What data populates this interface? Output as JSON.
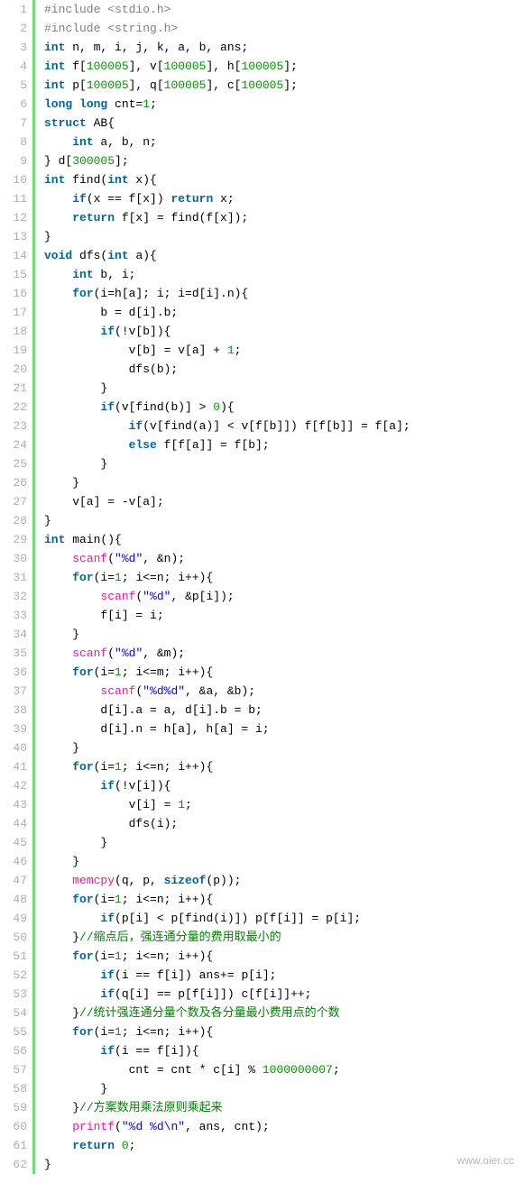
{
  "watermark": "www.oier.cc",
  "lines": [
    {
      "n": 1,
      "tokens": [
        [
          "pp",
          "#include <stdio.h>"
        ]
      ]
    },
    {
      "n": 2,
      "tokens": [
        [
          "pp",
          "#include <string.h>"
        ]
      ]
    },
    {
      "n": 3,
      "tokens": [
        [
          "kw",
          "int"
        ],
        [
          "id",
          " n, m, i, j, k, a, b, ans;"
        ]
      ]
    },
    {
      "n": 4,
      "tokens": [
        [
          "kw",
          "int"
        ],
        [
          "id",
          " f["
        ],
        [
          "num",
          "100005"
        ],
        [
          "id",
          "], v["
        ],
        [
          "num",
          "100005"
        ],
        [
          "id",
          "], h["
        ],
        [
          "num",
          "100005"
        ],
        [
          "id",
          "];"
        ]
      ]
    },
    {
      "n": 5,
      "tokens": [
        [
          "kw",
          "int"
        ],
        [
          "id",
          " p["
        ],
        [
          "num",
          "100005"
        ],
        [
          "id",
          "], q["
        ],
        [
          "num",
          "100005"
        ],
        [
          "id",
          "], c["
        ],
        [
          "num",
          "100005"
        ],
        [
          "id",
          "];"
        ]
      ]
    },
    {
      "n": 6,
      "tokens": [
        [
          "kw",
          "long"
        ],
        [
          "id",
          " "
        ],
        [
          "kw",
          "long"
        ],
        [
          "id",
          " cnt="
        ],
        [
          "num",
          "1"
        ],
        [
          "id",
          ";"
        ]
      ]
    },
    {
      "n": 7,
      "tokens": [
        [
          "kw",
          "struct"
        ],
        [
          "id",
          " AB{"
        ]
      ]
    },
    {
      "n": 8,
      "tokens": [
        [
          "id",
          "    "
        ],
        [
          "kw",
          "int"
        ],
        [
          "id",
          " a, b, n;"
        ]
      ]
    },
    {
      "n": 9,
      "tokens": [
        [
          "id",
          "} d["
        ],
        [
          "num",
          "300005"
        ],
        [
          "id",
          "];"
        ]
      ]
    },
    {
      "n": 10,
      "tokens": [
        [
          "kw",
          "int"
        ],
        [
          "id",
          " find("
        ],
        [
          "kw",
          "int"
        ],
        [
          "id",
          " x){"
        ]
      ]
    },
    {
      "n": 11,
      "tokens": [
        [
          "id",
          "    "
        ],
        [
          "kw",
          "if"
        ],
        [
          "id",
          "(x == f[x]) "
        ],
        [
          "kw",
          "return"
        ],
        [
          "id",
          " x;"
        ]
      ]
    },
    {
      "n": 12,
      "tokens": [
        [
          "id",
          "    "
        ],
        [
          "kw",
          "return"
        ],
        [
          "id",
          " f[x] = find(f[x]);"
        ]
      ]
    },
    {
      "n": 13,
      "tokens": [
        [
          "id",
          "}"
        ]
      ]
    },
    {
      "n": 14,
      "tokens": [
        [
          "kw",
          "void"
        ],
        [
          "id",
          " dfs("
        ],
        [
          "kw",
          "int"
        ],
        [
          "id",
          " a){"
        ]
      ]
    },
    {
      "n": 15,
      "tokens": [
        [
          "id",
          "    "
        ],
        [
          "kw",
          "int"
        ],
        [
          "id",
          " b, i;"
        ]
      ]
    },
    {
      "n": 16,
      "tokens": [
        [
          "id",
          "    "
        ],
        [
          "kw",
          "for"
        ],
        [
          "id",
          "(i=h[a]; i; i=d[i].n){"
        ]
      ]
    },
    {
      "n": 17,
      "tokens": [
        [
          "id",
          "        b = d[i].b;"
        ]
      ]
    },
    {
      "n": 18,
      "tokens": [
        [
          "id",
          "        "
        ],
        [
          "kw",
          "if"
        ],
        [
          "id",
          "(!v[b]){"
        ]
      ]
    },
    {
      "n": 19,
      "tokens": [
        [
          "id",
          "            v[b] = v[a] + "
        ],
        [
          "num",
          "1"
        ],
        [
          "id",
          ";"
        ]
      ]
    },
    {
      "n": 20,
      "tokens": [
        [
          "id",
          "            dfs(b);"
        ]
      ]
    },
    {
      "n": 21,
      "tokens": [
        [
          "id",
          "        }"
        ]
      ]
    },
    {
      "n": 22,
      "tokens": [
        [
          "id",
          "        "
        ],
        [
          "kw",
          "if"
        ],
        [
          "id",
          "(v[find(b)] > "
        ],
        [
          "num",
          "0"
        ],
        [
          "id",
          "){"
        ]
      ]
    },
    {
      "n": 23,
      "tokens": [
        [
          "id",
          "            "
        ],
        [
          "kw",
          "if"
        ],
        [
          "id",
          "(v[find(a)] < v[f[b]]) f[f[b]] = f[a];"
        ]
      ]
    },
    {
      "n": 24,
      "tokens": [
        [
          "id",
          "            "
        ],
        [
          "kw",
          "else"
        ],
        [
          "id",
          " f[f[a]] = f[b];"
        ]
      ]
    },
    {
      "n": 25,
      "tokens": [
        [
          "id",
          "        }"
        ]
      ]
    },
    {
      "n": 26,
      "tokens": [
        [
          "id",
          "    }"
        ]
      ]
    },
    {
      "n": 27,
      "tokens": [
        [
          "id",
          "    v[a] = -v[a];"
        ]
      ]
    },
    {
      "n": 28,
      "tokens": [
        [
          "id",
          "}"
        ]
      ]
    },
    {
      "n": 29,
      "tokens": [
        [
          "kw",
          "int"
        ],
        [
          "id",
          " main(){"
        ]
      ]
    },
    {
      "n": 30,
      "tokens": [
        [
          "id",
          "    "
        ],
        [
          "fn",
          "scanf"
        ],
        [
          "id",
          "("
        ],
        [
          "str",
          "\"%d\""
        ],
        [
          "id",
          ", &n);"
        ]
      ]
    },
    {
      "n": 31,
      "tokens": [
        [
          "id",
          "    "
        ],
        [
          "kw",
          "for"
        ],
        [
          "id",
          "(i="
        ],
        [
          "num",
          "1"
        ],
        [
          "id",
          "; i<=n; i++){"
        ]
      ]
    },
    {
      "n": 32,
      "tokens": [
        [
          "id",
          "        "
        ],
        [
          "fn",
          "scanf"
        ],
        [
          "id",
          "("
        ],
        [
          "str",
          "\"%d\""
        ],
        [
          "id",
          ", &p[i]);"
        ]
      ]
    },
    {
      "n": 33,
      "tokens": [
        [
          "id",
          "        f[i] = i;"
        ]
      ]
    },
    {
      "n": 34,
      "tokens": [
        [
          "id",
          "    }"
        ]
      ]
    },
    {
      "n": 35,
      "tokens": [
        [
          "id",
          "    "
        ],
        [
          "fn",
          "scanf"
        ],
        [
          "id",
          "("
        ],
        [
          "str",
          "\"%d\""
        ],
        [
          "id",
          ", &m);"
        ]
      ]
    },
    {
      "n": 36,
      "tokens": [
        [
          "id",
          "    "
        ],
        [
          "kw",
          "for"
        ],
        [
          "id",
          "(i="
        ],
        [
          "num",
          "1"
        ],
        [
          "id",
          "; i<=m; i++){"
        ]
      ]
    },
    {
      "n": 37,
      "tokens": [
        [
          "id",
          "        "
        ],
        [
          "fn",
          "scanf"
        ],
        [
          "id",
          "("
        ],
        [
          "str",
          "\"%d%d\""
        ],
        [
          "id",
          ", &a, &b);"
        ]
      ]
    },
    {
      "n": 38,
      "tokens": [
        [
          "id",
          "        d[i].a = a, d[i].b = b;"
        ]
      ]
    },
    {
      "n": 39,
      "tokens": [
        [
          "id",
          "        d[i].n = h[a], h[a] = i;"
        ]
      ]
    },
    {
      "n": 40,
      "tokens": [
        [
          "id",
          "    }"
        ]
      ]
    },
    {
      "n": 41,
      "tokens": [
        [
          "id",
          "    "
        ],
        [
          "kw",
          "for"
        ],
        [
          "id",
          "(i="
        ],
        [
          "num",
          "1"
        ],
        [
          "id",
          "; i<=n; i++){"
        ]
      ]
    },
    {
      "n": 42,
      "tokens": [
        [
          "id",
          "        "
        ],
        [
          "kw",
          "if"
        ],
        [
          "id",
          "(!v[i]){"
        ]
      ]
    },
    {
      "n": 43,
      "tokens": [
        [
          "id",
          "            v[i] = "
        ],
        [
          "num",
          "1"
        ],
        [
          "id",
          ";"
        ]
      ]
    },
    {
      "n": 44,
      "tokens": [
        [
          "id",
          "            dfs(i);"
        ]
      ]
    },
    {
      "n": 45,
      "tokens": [
        [
          "id",
          "        }"
        ]
      ]
    },
    {
      "n": 46,
      "tokens": [
        [
          "id",
          "    }"
        ]
      ]
    },
    {
      "n": 47,
      "tokens": [
        [
          "id",
          "    "
        ],
        [
          "fn",
          "memcpy"
        ],
        [
          "id",
          "(q, p, "
        ],
        [
          "kw",
          "sizeof"
        ],
        [
          "id",
          "(p));"
        ]
      ]
    },
    {
      "n": 48,
      "tokens": [
        [
          "id",
          "    "
        ],
        [
          "kw",
          "for"
        ],
        [
          "id",
          "(i="
        ],
        [
          "num",
          "1"
        ],
        [
          "id",
          "; i<=n; i++){"
        ]
      ]
    },
    {
      "n": 49,
      "tokens": [
        [
          "id",
          "        "
        ],
        [
          "kw",
          "if"
        ],
        [
          "id",
          "(p[i] < p[find(i)]) p[f[i]] = p[i];"
        ]
      ]
    },
    {
      "n": 50,
      "tokens": [
        [
          "id",
          "    }"
        ],
        [
          "cm",
          "//缩点后，强连通分量的费用取最小的"
        ]
      ]
    },
    {
      "n": 51,
      "tokens": [
        [
          "id",
          "    "
        ],
        [
          "kw",
          "for"
        ],
        [
          "id",
          "(i="
        ],
        [
          "num",
          "1"
        ],
        [
          "id",
          "; i<=n; i++){"
        ]
      ]
    },
    {
      "n": 52,
      "tokens": [
        [
          "id",
          "        "
        ],
        [
          "kw",
          "if"
        ],
        [
          "id",
          "(i == f[i]) ans+= p[i];"
        ]
      ]
    },
    {
      "n": 53,
      "tokens": [
        [
          "id",
          "        "
        ],
        [
          "kw",
          "if"
        ],
        [
          "id",
          "(q[i] == p[f[i]]) c[f[i]]++;"
        ]
      ]
    },
    {
      "n": 54,
      "tokens": [
        [
          "id",
          "    }"
        ],
        [
          "cm",
          "//统计强连通分量个数及各分量最小费用点的个数"
        ]
      ]
    },
    {
      "n": 55,
      "tokens": [
        [
          "id",
          "    "
        ],
        [
          "kw",
          "for"
        ],
        [
          "id",
          "(i="
        ],
        [
          "num",
          "1"
        ],
        [
          "id",
          "; i<=n; i++){"
        ]
      ]
    },
    {
      "n": 56,
      "tokens": [
        [
          "id",
          "        "
        ],
        [
          "kw",
          "if"
        ],
        [
          "id",
          "(i == f[i]){"
        ]
      ]
    },
    {
      "n": 57,
      "tokens": [
        [
          "id",
          "            cnt = cnt * c[i] % "
        ],
        [
          "num",
          "1000000007"
        ],
        [
          "id",
          ";"
        ]
      ]
    },
    {
      "n": 58,
      "tokens": [
        [
          "id",
          "        }"
        ]
      ]
    },
    {
      "n": 59,
      "tokens": [
        [
          "id",
          "    }"
        ],
        [
          "cm",
          "//方案数用乘法原则乘起来"
        ]
      ]
    },
    {
      "n": 60,
      "tokens": [
        [
          "id",
          "    "
        ],
        [
          "fn",
          "printf"
        ],
        [
          "id",
          "("
        ],
        [
          "str",
          "\"%d %d\\n\""
        ],
        [
          "id",
          ", ans, cnt);"
        ]
      ]
    },
    {
      "n": 61,
      "tokens": [
        [
          "id",
          "    "
        ],
        [
          "kw",
          "return"
        ],
        [
          "id",
          " "
        ],
        [
          "num",
          "0"
        ],
        [
          "id",
          ";"
        ]
      ]
    },
    {
      "n": 62,
      "tokens": [
        [
          "id",
          "}"
        ]
      ]
    }
  ]
}
